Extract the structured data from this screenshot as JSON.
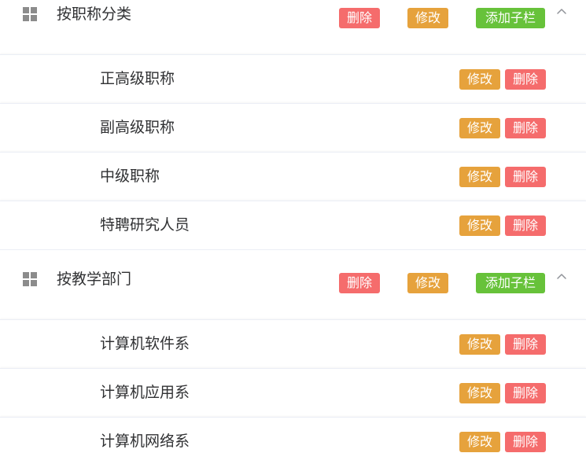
{
  "groups": [
    {
      "title": "按职称分类",
      "delete_label": "删除",
      "edit_label": "修改",
      "add_child_label": "添加子栏",
      "children": [
        {
          "label": "正高级职称",
          "edit_label": "修改",
          "delete_label": "删除"
        },
        {
          "label": "副高级职称",
          "edit_label": "修改",
          "delete_label": "删除"
        },
        {
          "label": "中级职称",
          "edit_label": "修改",
          "delete_label": "删除"
        },
        {
          "label": "特聘研究人员",
          "edit_label": "修改",
          "delete_label": "删除"
        }
      ]
    },
    {
      "title": "按教学部门",
      "delete_label": "删除",
      "edit_label": "修改",
      "add_child_label": "添加子栏",
      "children": [
        {
          "label": "计算机软件系",
          "edit_label": "修改",
          "delete_label": "删除"
        },
        {
          "label": "计算机应用系",
          "edit_label": "修改",
          "delete_label": "删除"
        },
        {
          "label": "计算机网络系",
          "edit_label": "修改",
          "delete_label": "删除"
        }
      ]
    }
  ],
  "icons": {
    "group_icon": "grid-icon",
    "collapse_icon": "chevron-up-icon"
  },
  "colors": {
    "danger": "#f56c6c",
    "warning": "#e6a23c",
    "success": "#67c23a",
    "text": "#303133",
    "icon": "#8c8c8c",
    "divider": "#ebeef5"
  }
}
